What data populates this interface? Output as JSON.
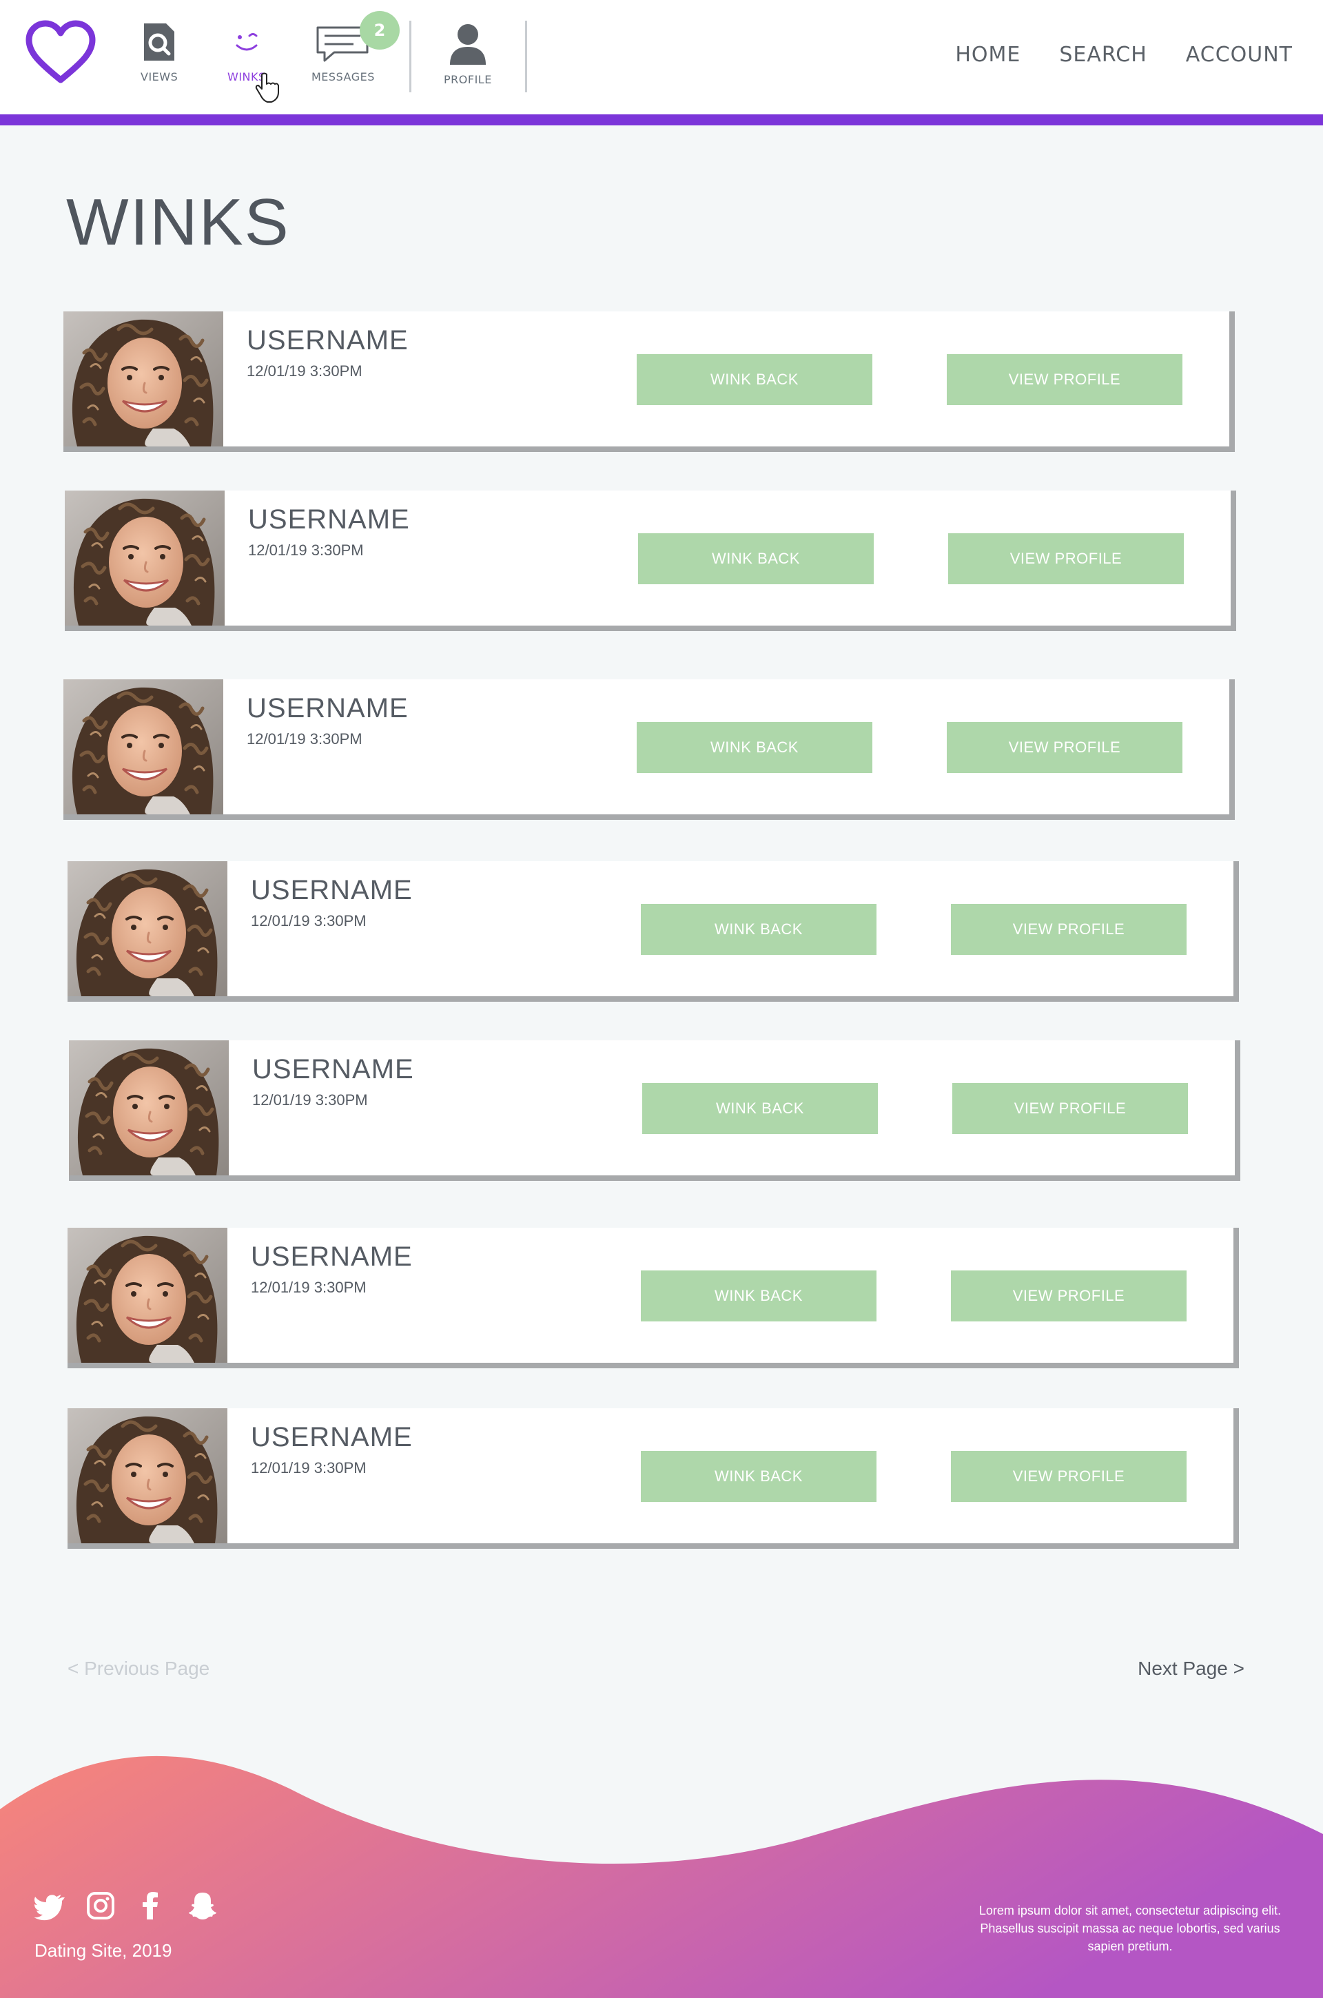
{
  "header": {
    "nav": [
      {
        "label": "VIEWS",
        "icon": "magnifier-icon"
      },
      {
        "label": "WINKS",
        "icon": "wink-face-icon",
        "active": true
      },
      {
        "label": "MESSAGES",
        "icon": "chat-bubble-icon",
        "badge": "2"
      },
      {
        "label": "PROFILE",
        "icon": "person-icon"
      }
    ],
    "links": {
      "home": "HOME",
      "search": "SEARCH",
      "account": "ACCOUNT"
    }
  },
  "page": {
    "title": "WINKS"
  },
  "winks": [
    {
      "username": "USERNAME",
      "timestamp": "12/01/19 3:30PM",
      "wink_back_label": "WINK BACK",
      "view_profile_label": "VIEW PROFILE"
    },
    {
      "username": "USERNAME",
      "timestamp": "12/01/19 3:30PM",
      "wink_back_label": "WINK BACK",
      "view_profile_label": "VIEW PROFILE"
    },
    {
      "username": "USERNAME",
      "timestamp": "12/01/19 3:30PM",
      "wink_back_label": "WINK BACK",
      "view_profile_label": "VIEW PROFILE"
    },
    {
      "username": "USERNAME",
      "timestamp": "12/01/19 3:30PM",
      "wink_back_label": "WINK BACK",
      "view_profile_label": "VIEW PROFILE"
    },
    {
      "username": "USERNAME",
      "timestamp": "12/01/19 3:30PM",
      "wink_back_label": "WINK BACK",
      "view_profile_label": "VIEW PROFILE"
    },
    {
      "username": "USERNAME",
      "timestamp": "12/01/19 3:30PM",
      "wink_back_label": "WINK BACK",
      "view_profile_label": "VIEW PROFILE"
    },
    {
      "username": "USERNAME",
      "timestamp": "12/01/19 3:30PM",
      "wink_back_label": "WINK BACK",
      "view_profile_label": "VIEW PROFILE"
    }
  ],
  "pagination": {
    "previous": "< Previous Page",
    "next": "Next Page >"
  },
  "footer": {
    "copyright": "Dating Site, 2019",
    "text": "Lorem ipsum dolor sit amet, consectetur adipiscing elit. Phasellus suscipit massa ac neque lobortis, sed varius sapien pretium.",
    "socials": [
      "twitter-icon",
      "instagram-icon",
      "facebook-icon",
      "snapchat-icon"
    ]
  },
  "colors": {
    "accent": "#7b35d9",
    "button": "#aed7aa",
    "badge": "#a8d8a4",
    "footer_gradient_start": "#f7867a",
    "footer_gradient_end": "#b456c4"
  }
}
